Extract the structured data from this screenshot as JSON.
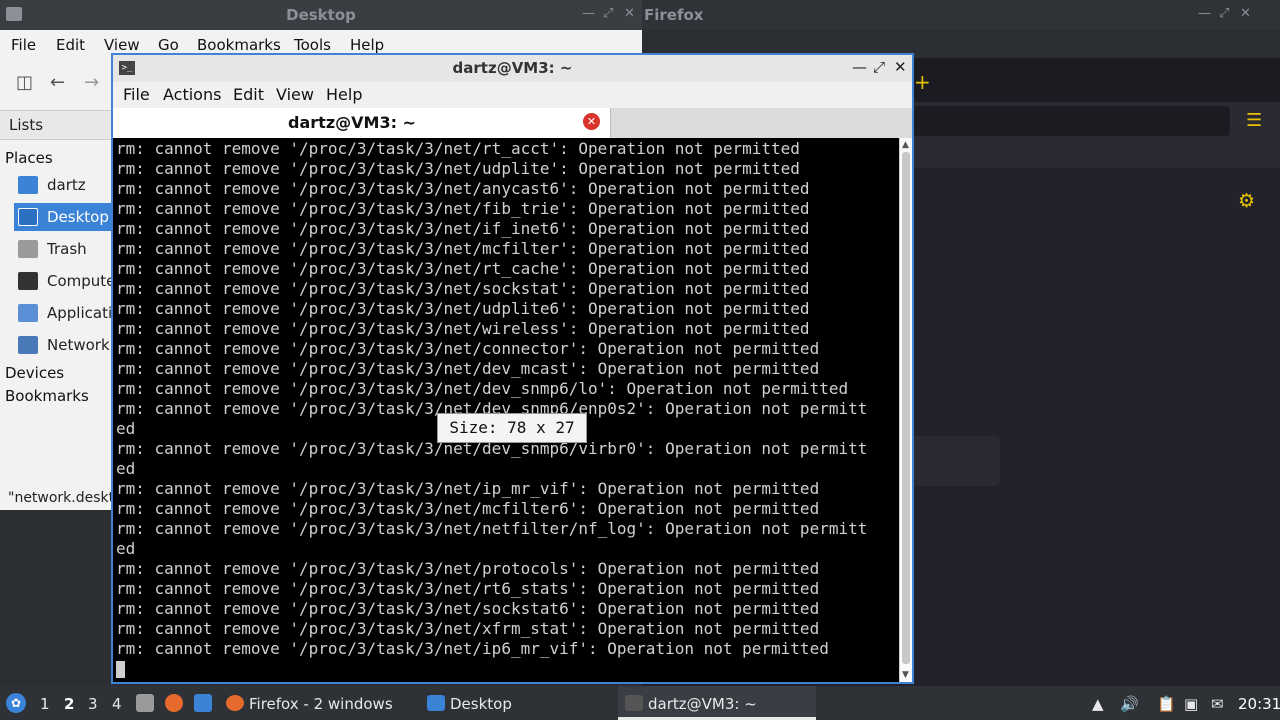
{
  "file_manager": {
    "title": "Desktop",
    "menu": [
      "File",
      "Edit",
      "View",
      "Go",
      "Bookmarks",
      "Tools",
      "Help"
    ],
    "sidebar": {
      "mode": "Lists",
      "places_header": "Places",
      "places": [
        {
          "label": "dartz",
          "icon": "home-folder-icon",
          "color": "#3b83d6"
        },
        {
          "label": "Desktop",
          "icon": "desktop-icon",
          "color": "#3b83d6",
          "selected": true
        },
        {
          "label": "Trash",
          "icon": "trash-icon",
          "color": "#9a9a9a"
        },
        {
          "label": "Computer",
          "icon": "computer-icon",
          "color": "#333333"
        },
        {
          "label": "Applications",
          "icon": "applications-icon",
          "color": "#5a8fd6"
        },
        {
          "label": "Network",
          "icon": "network-icon",
          "color": "#4a79b8"
        }
      ],
      "devices_header": "Devices",
      "bookmarks_header": "Bookmarks"
    },
    "status": "\"network.desktop\""
  },
  "firefox": {
    "title": "Firefox"
  },
  "terminal": {
    "title": "dartz@VM3: ~",
    "menu": [
      "File",
      "Actions",
      "Edit",
      "View",
      "Help"
    ],
    "tab_label": "dartz@VM3: ~",
    "size_tooltip": "Size: 78 x 27",
    "lines": [
      "rm: cannot remove '/proc/3/task/3/net/rt_acct': Operation not permitted",
      "rm: cannot remove '/proc/3/task/3/net/udplite': Operation not permitted",
      "rm: cannot remove '/proc/3/task/3/net/anycast6': Operation not permitted",
      "rm: cannot remove '/proc/3/task/3/net/fib_trie': Operation not permitted",
      "rm: cannot remove '/proc/3/task/3/net/if_inet6': Operation not permitted",
      "rm: cannot remove '/proc/3/task/3/net/mcfilter': Operation not permitted",
      "rm: cannot remove '/proc/3/task/3/net/rt_cache': Operation not permitted",
      "rm: cannot remove '/proc/3/task/3/net/sockstat': Operation not permitted",
      "rm: cannot remove '/proc/3/task/3/net/udplite6': Operation not permitted",
      "rm: cannot remove '/proc/3/task/3/net/wireless': Operation not permitted",
      "rm: cannot remove '/proc/3/task/3/net/connector': Operation not permitted",
      "rm: cannot remove '/proc/3/task/3/net/dev_mcast': Operation not permitted",
      "rm: cannot remove '/proc/3/task/3/net/dev_snmp6/lo': Operation not permitted",
      "rm: cannot remove '/proc/3/task/3/net/dev_snmp6/enp0s2': Operation not permitt",
      "ed",
      "rm: cannot remove '/proc/3/task/3/net/dev_snmp6/virbr0': Operation not permitt",
      "ed",
      "rm: cannot remove '/proc/3/task/3/net/ip_mr_vif': Operation not permitted",
      "rm: cannot remove '/proc/3/task/3/net/mcfilter6': Operation not permitted",
      "rm: cannot remove '/proc/3/task/3/net/netfilter/nf_log': Operation not permitt",
      "ed",
      "rm: cannot remove '/proc/3/task/3/net/protocols': Operation not permitted",
      "rm: cannot remove '/proc/3/task/3/net/rt6_stats': Operation not permitted",
      "rm: cannot remove '/proc/3/task/3/net/sockstat6': Operation not permitted",
      "rm: cannot remove '/proc/3/task/3/net/xfrm_stat': Operation not permitted",
      "rm: cannot remove '/proc/3/task/3/net/ip6_mr_vif': Operation not permitted"
    ]
  },
  "taskbar": {
    "workspaces": [
      "1",
      "2",
      "3",
      "4"
    ],
    "current_workspace": "2",
    "tasks": [
      {
        "label": "Firefox - 2 windows",
        "icon": "firefox-icon"
      },
      {
        "label": "Desktop",
        "icon": "folder-icon"
      },
      {
        "label": "dartz@VM3: ~",
        "icon": "terminal-icon"
      }
    ],
    "clock": "20:31"
  }
}
